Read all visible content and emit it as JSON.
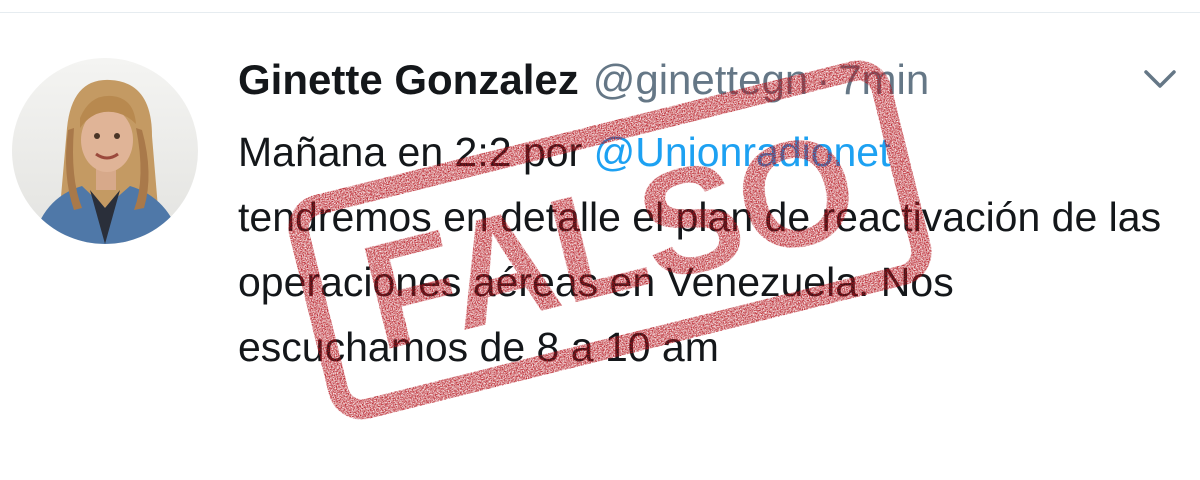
{
  "tweet": {
    "author_name": "Ginette Gonzalez",
    "author_handle": "@ginettegn",
    "separator": "·",
    "timestamp": "7min",
    "body_before_mention": "Mañana en 2:2 por ",
    "mention": "@Unionradionet",
    "body_after_mention": "\ntendremos en detalle el plan de reactivación de las operaciones aéreas en Venezuela.  Nos escuchamos de 8 a 10 am",
    "menu_icon": "chevron-down-icon",
    "avatar_icon": "avatar"
  },
  "stamp": {
    "text": "FALSO",
    "color": "#b3121b"
  },
  "colors": {
    "text": "#14171a",
    "secondary": "#657786",
    "link": "#1da1f2",
    "divider": "#e6ecf0"
  }
}
